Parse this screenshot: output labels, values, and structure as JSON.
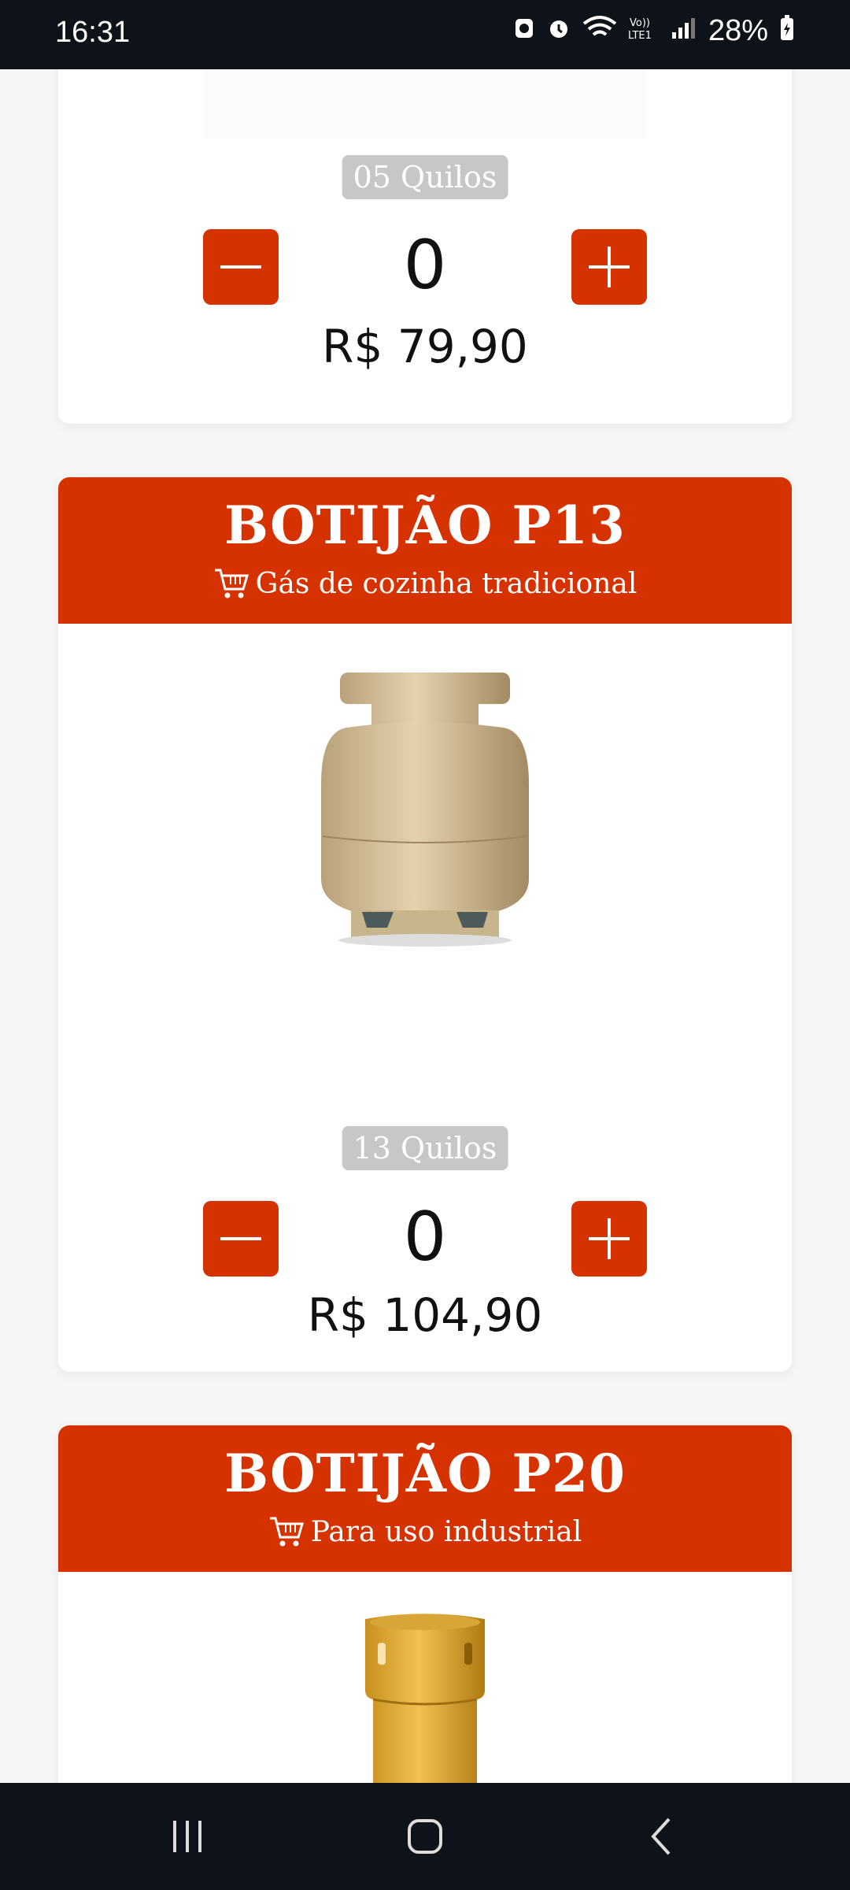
{
  "status_bar": {
    "time": "16:31",
    "battery": "28%"
  },
  "cards": [
    {
      "id": "p05",
      "weight": "05 Quilos",
      "quantity": "0",
      "price": "R$ 79,90"
    },
    {
      "id": "p13",
      "title": "BOTIJÃO P13",
      "subtitle": "Gás de cozinha tradicional",
      "image_alt": "gas cylinder P13",
      "weight": "13 Quilos",
      "quantity": "0",
      "price": "R$ 104,90"
    },
    {
      "id": "p20",
      "title": "BOTIJÃO P20",
      "subtitle": "Para uso industrial",
      "image_alt": "gas cylinder P20"
    }
  ],
  "colors": {
    "accent": "#d63200",
    "badge": "#c7c7c7",
    "bar": "#0e131a"
  },
  "icons": {
    "minus": "minus-icon",
    "plus": "plus-icon",
    "cart": "cart-icon"
  }
}
